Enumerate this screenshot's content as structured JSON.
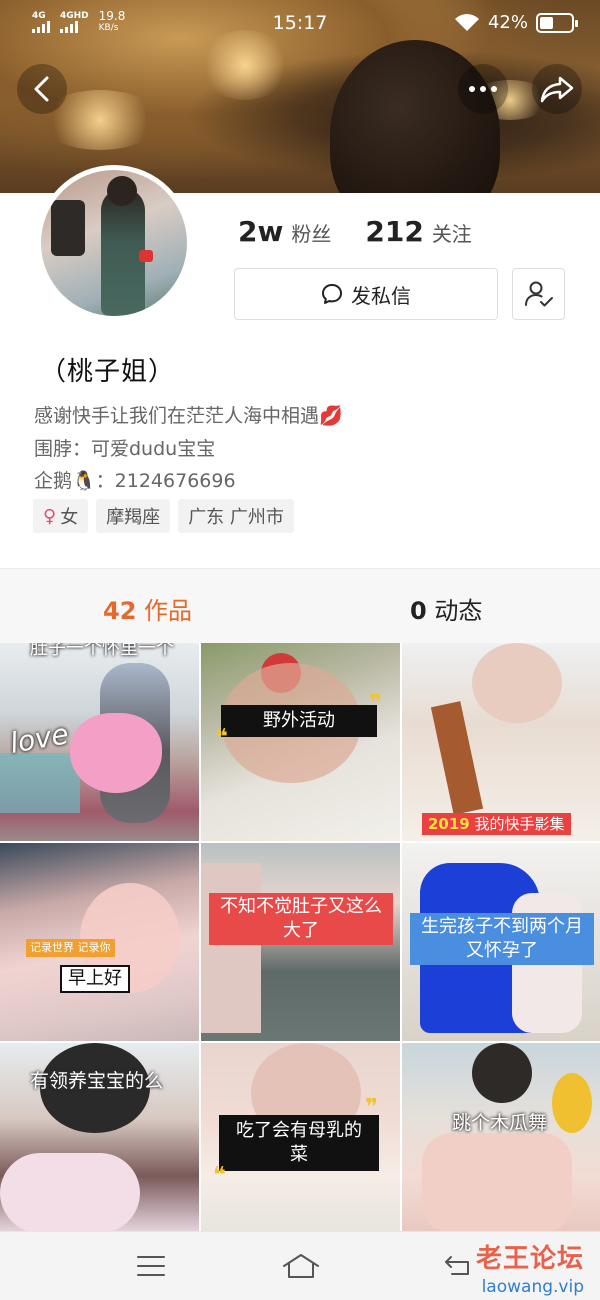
{
  "status_bar": {
    "network_1": "4G",
    "network_2": "4GHD",
    "speed_value": "19.8",
    "speed_unit": "KB/s",
    "time": "15:17",
    "battery_percent": "42%",
    "battery_level": 0.42
  },
  "header": {
    "back_icon": "chevron-left-icon",
    "more_icon": "more-dots-icon",
    "share_icon": "share-arrow-icon"
  },
  "profile": {
    "followers_count": "2w",
    "followers_label": "粉丝",
    "following_count": "212",
    "following_label": "关注",
    "message_button": "发私信",
    "nickname": "（桃子姐）",
    "bio_line1": "感谢快手让我们在茫茫人海中相遇💋",
    "bio_line2": "围脖：可爱dudu宝宝",
    "bio_line3": "企鹅🐧：2124676696",
    "tags": [
      "女",
      "摩羯座",
      "广东 广州市"
    ]
  },
  "tabs": [
    {
      "count": "42",
      "label": "作品",
      "active": true
    },
    {
      "count": "0",
      "label": "动态",
      "active": false
    }
  ],
  "videos": [
    {
      "caption": "肚子一个怀里一个",
      "sticker": "love"
    },
    {
      "caption": "野外活动"
    },
    {
      "caption": "我的快手影集",
      "badge": "2019"
    },
    {
      "caption": "早上好",
      "badge": "记录世界 记录你"
    },
    {
      "caption": "不知不觉肚子又这么大了"
    },
    {
      "caption": "生完孩子不到两个月又怀孕了"
    },
    {
      "caption": "有领养宝宝的么"
    },
    {
      "caption": "吃了会有母乳的菜"
    },
    {
      "caption": "跳个木瓜舞"
    }
  ],
  "nav": {
    "menu_icon": "menu-icon",
    "home_icon": "home-icon",
    "back_icon": "back-icon"
  },
  "watermark": {
    "title": "老王论坛",
    "url": "laowang.vip"
  }
}
